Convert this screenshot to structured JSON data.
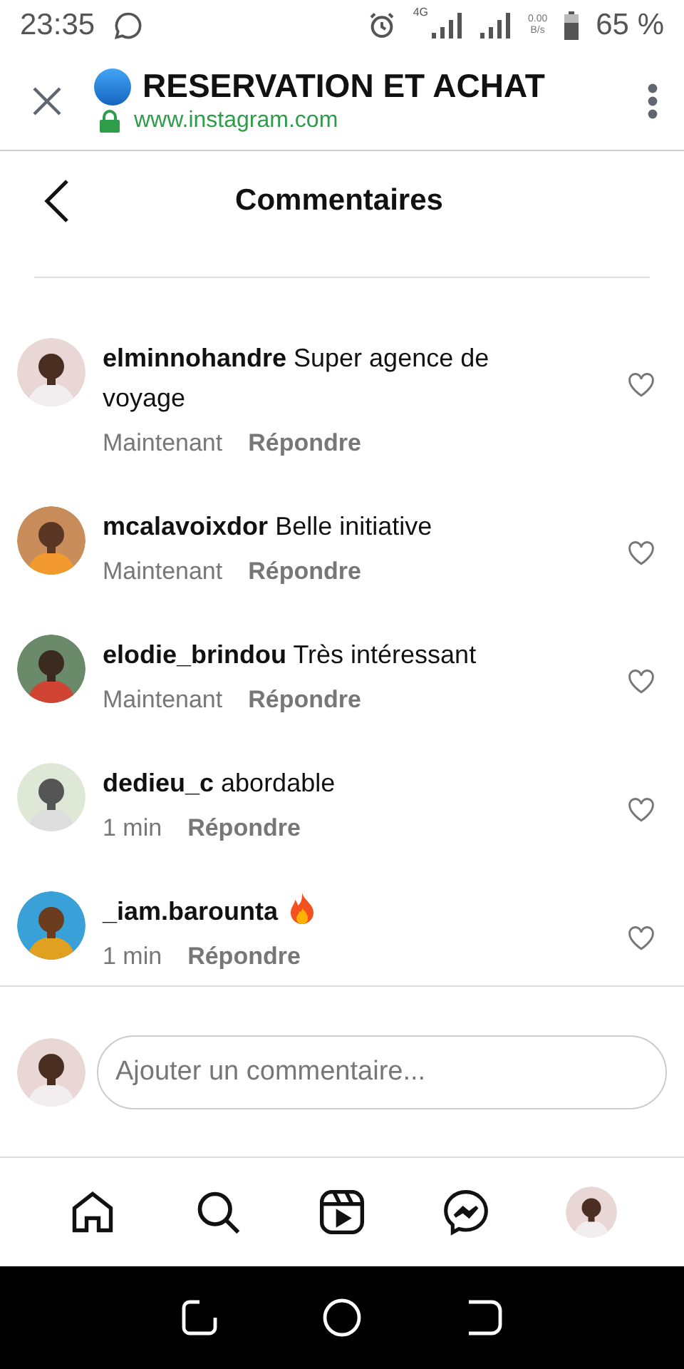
{
  "status_bar": {
    "time": "23:35",
    "network": "4G",
    "speed_value": "0.00",
    "speed_unit": "B/s",
    "battery": "65 %"
  },
  "browser": {
    "title": "RESERVATION ET ACHAT",
    "url": "www.instagram.com"
  },
  "header": {
    "title": "Commentaires"
  },
  "comments": [
    {
      "username": "elminnohandre",
      "text": "Super agence de voyage",
      "time": "Maintenant",
      "reply": "Répondre",
      "flame": false
    },
    {
      "username": "mcalavoixdor",
      "text": "Belle initiative",
      "time": "Maintenant",
      "reply": "Répondre",
      "flame": false
    },
    {
      "username": "elodie_brindou",
      "text": "Très intéressant",
      "time": "Maintenant",
      "reply": "Répondre",
      "flame": false
    },
    {
      "username": "dedieu_c",
      "text": "abordable",
      "time": "1 min",
      "reply": "Répondre",
      "flame": false
    },
    {
      "username": "_iam.barounta",
      "time": "1 min",
      "reply": "Répondre",
      "flame": true
    }
  ],
  "composer": {
    "placeholder": "Ajouter un commentaire..."
  }
}
